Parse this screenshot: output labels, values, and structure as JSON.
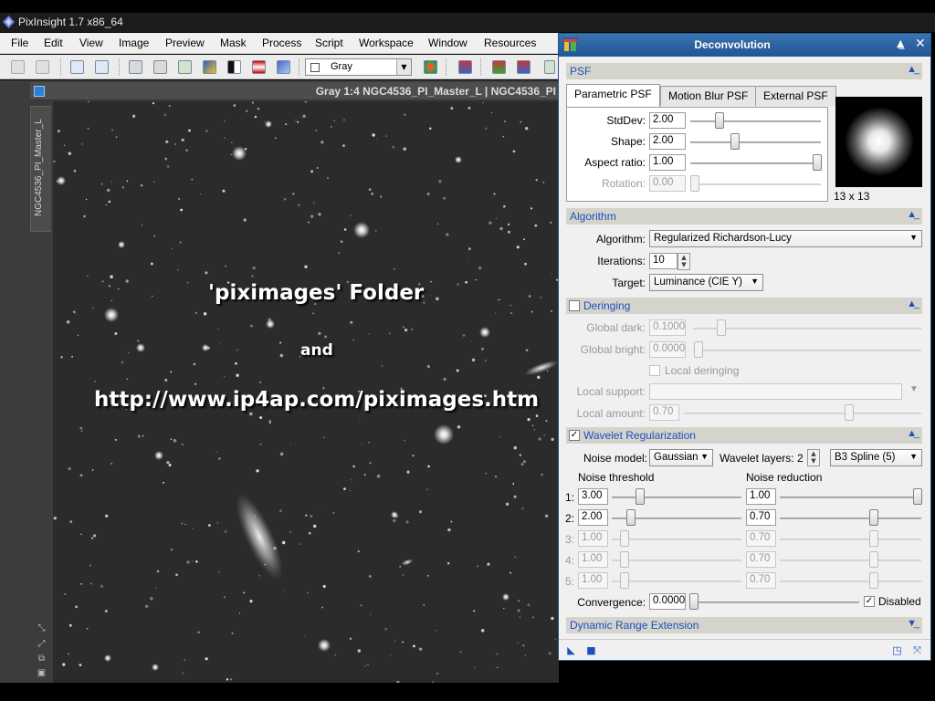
{
  "app": {
    "title": "PixInsight 1.7 x86_64"
  },
  "menu": [
    "File",
    "Edit",
    "View",
    "Image",
    "Preview",
    "Mask",
    "Process",
    "Script",
    "Workspace",
    "Window",
    "Resources"
  ],
  "toolbar": {
    "rgb_channel": "Gray"
  },
  "image_window": {
    "title": "Gray 1:4 NGC4536_PI_Master_L | NGC4536_PI",
    "side_tab": "NGC4536_PI_Master_L"
  },
  "overlay": {
    "line1": "'piximages' Folder",
    "line2": "and",
    "line3": "http://www.ip4ap.com/piximages.htm"
  },
  "dialog": {
    "title": "Deconvolution",
    "psf": {
      "section": "PSF",
      "tabs": [
        "Parametric PSF",
        "Motion Blur PSF",
        "External PSF"
      ],
      "active_tab": "Parametric PSF",
      "stddev": {
        "label": "StdDev:",
        "value": "2.00"
      },
      "shape": {
        "label": "Shape:",
        "value": "2.00"
      },
      "aspect": {
        "label": "Aspect ratio:",
        "value": "1.00"
      },
      "rotation": {
        "label": "Rotation:",
        "value": "0.00"
      },
      "preview_size": "13 x 13"
    },
    "algorithm": {
      "section": "Algorithm",
      "algorithm_label": "Algorithm:",
      "algorithm_value": "Regularized Richardson-Lucy",
      "iterations_label": "Iterations:",
      "iterations_value": "10",
      "target_label": "Target:",
      "target_value": "Luminance (CIE Y)"
    },
    "deringing": {
      "section": "Deringing",
      "enabled": false,
      "global_dark": {
        "label": "Global dark:",
        "value": "0.1000"
      },
      "global_bright": {
        "label": "Global bright:",
        "value": "0.0000"
      },
      "local_deringing": "Local deringing",
      "local_support_label": "Local support:",
      "local_amount": {
        "label": "Local amount:",
        "value": "0.70"
      }
    },
    "wavelet": {
      "section": "Wavelet Regularization",
      "enabled": true,
      "noise_model_label": "Noise model:",
      "noise_model_value": "Gaussian",
      "layers_label": "Wavelet layers:",
      "layers_value": "2",
      "scaling_value": "B3 Spline (5)",
      "col_threshold": "Noise threshold",
      "col_reduction": "Noise reduction",
      "rows": [
        {
          "n": "1:",
          "threshold": "3.00",
          "reduction": "1.00"
        },
        {
          "n": "2:",
          "threshold": "2.00",
          "reduction": "0.70"
        },
        {
          "n": "3:",
          "threshold": "1.00",
          "reduction": "0.70"
        },
        {
          "n": "4:",
          "threshold": "1.00",
          "reduction": "0.70"
        },
        {
          "n": "5:",
          "threshold": "1.00",
          "reduction": "0.70"
        }
      ],
      "convergence_label": "Convergence:",
      "convergence_value": "0.0000",
      "disabled_label": "Disabled",
      "disabled_checked": true
    },
    "dynamic_range": {
      "section": "Dynamic Range Extension"
    }
  }
}
